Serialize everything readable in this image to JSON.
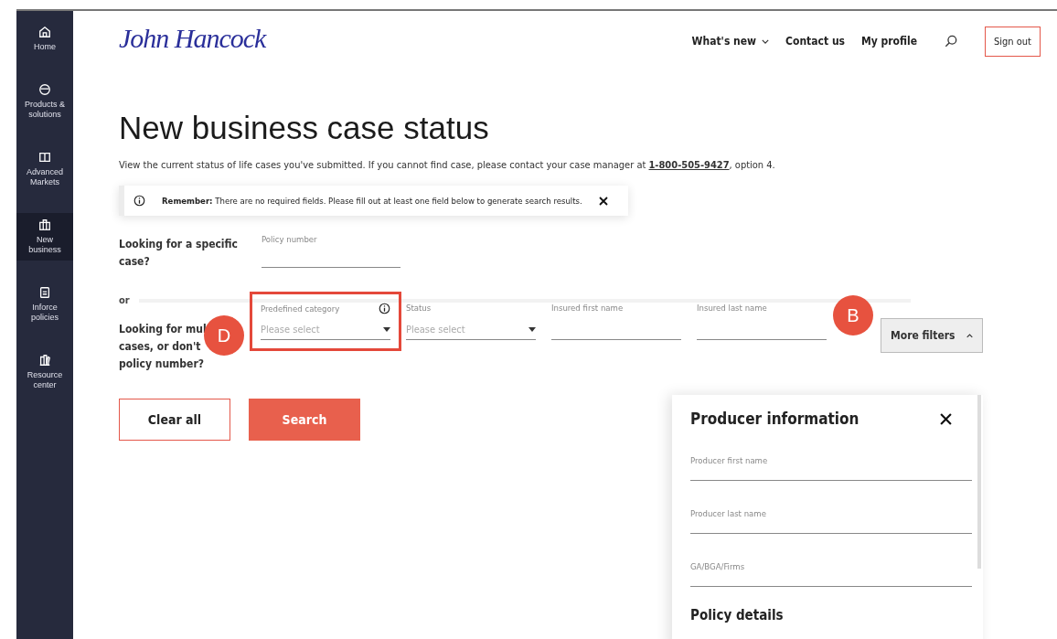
{
  "sidebar": {
    "items": [
      {
        "label": "Home",
        "selected": false
      },
      {
        "label": "Products & solutions",
        "selected": false
      },
      {
        "label": "Advanced Markets",
        "selected": false
      },
      {
        "label": "New business",
        "selected": true
      },
      {
        "label": "Inforce policies",
        "selected": false
      },
      {
        "label": "Resource center",
        "selected": false
      }
    ]
  },
  "header": {
    "logo": "John Hancock",
    "nav": [
      {
        "label": "What's new",
        "dropdown": true
      },
      {
        "label": "Contact us",
        "dropdown": false
      },
      {
        "label": "My profile",
        "dropdown": false
      }
    ],
    "sign_out": "Sign out"
  },
  "title": "New business case status",
  "intro": {
    "text": "View the current status of life cases you've submitted. If you cannot find case, please contact your case manager at ",
    "phone": "1-800-505-9427",
    "after": ", option 4."
  },
  "notice": {
    "text": "**Remember:** There are no required fields. Please fill out at least one field below to generate search results."
  },
  "specific": {
    "label": "Looking for a specific case?",
    "field": {
      "label": "Policy number"
    }
  },
  "or": "or",
  "multiple": {
    "label_lines": [
      "Looking for mul",
      "cases, or don't",
      "policy number?"
    ],
    "fields": [
      {
        "kind": "select",
        "label": "Predefined category",
        "placeholder": "Please select",
        "info": true,
        "highlighted": true
      },
      {
        "kind": "select",
        "label": "Status",
        "placeholder": "Please select",
        "info": false,
        "highlighted": false
      },
      {
        "kind": "text",
        "label": "Insured first name",
        "info": false,
        "highlighted": false
      },
      {
        "kind": "text",
        "label": "Insured last name",
        "info": false,
        "highlighted": false
      }
    ],
    "more_filters": {
      "label": "More filters",
      "expanded": true
    }
  },
  "buttons": {
    "clear": "Clear all",
    "search": "Search"
  },
  "annotations": [
    {
      "label": "D"
    },
    {
      "label": "B"
    }
  ],
  "panel": {
    "title": "Producer information",
    "fields": [
      {
        "label": "Producer first name"
      },
      {
        "label": "Producer last name"
      },
      {
        "label": "GA/BGA/Firms"
      }
    ],
    "next_section": "Policy details"
  }
}
